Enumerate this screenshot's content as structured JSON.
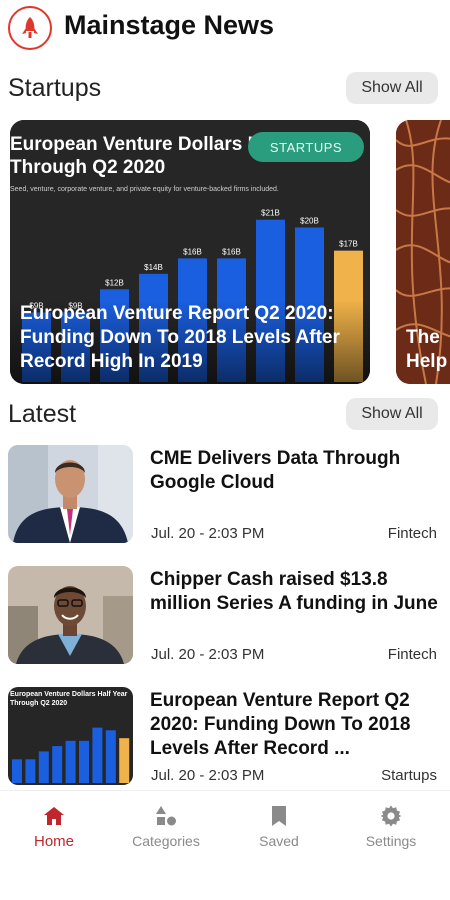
{
  "app": {
    "title": "Mainstage News",
    "logo_icon": "rocket-icon",
    "brand_color": "#e0372b"
  },
  "startups": {
    "section_title": "Startups",
    "show_all_label": "Show All",
    "feature": {
      "tag": "STARTUPS",
      "title": "European Venture Report Q2 2020: Funding Down To 2018 Levels After Record High In 2019",
      "image": {
        "heading_line1": "European Venture Dollars Half Year",
        "heading_line2": "Through Q2 2020",
        "subheading": "Seed, venture, corporate venture, and private equity for venture-backed firms included.",
        "bars": [
          {
            "label": "$9B",
            "value": 9
          },
          {
            "label": "$9B",
            "value": 9
          },
          {
            "label": "$12B",
            "value": 12
          },
          {
            "label": "$14B",
            "value": 14
          },
          {
            "label": "$16B",
            "value": 16
          },
          {
            "label": "$16B",
            "value": 16
          },
          {
            "label": "$21B",
            "value": 21
          },
          {
            "label": "$20B",
            "value": 20
          },
          {
            "label": "$17B",
            "value": 17
          }
        ],
        "bar_color": "#1a5fe0",
        "highlight_color": "#f0b24a"
      }
    },
    "peek": {
      "title": "The\nHelp"
    }
  },
  "latest": {
    "section_title": "Latest",
    "show_all_label": "Show All",
    "articles": [
      {
        "title": "CME Delivers Data Through Google Cloud",
        "time": "Jul. 20 - 2:03 PM",
        "category": "Fintech",
        "thumb": "man-in-suit"
      },
      {
        "title": "Chipper Cash raised $13.8 million Series A funding in June",
        "time": "Jul. 20 - 2:03 PM",
        "category": "Fintech",
        "thumb": "smiling-man"
      },
      {
        "title": "European Venture Report Q2 2020: Funding Down To 2018 Levels After Record ...",
        "time": "Jul. 20 - 2:03 PM",
        "category": "Startups",
        "thumb": "bar-chart"
      }
    ]
  },
  "nav": {
    "items": [
      {
        "label": "Home",
        "icon": "home-icon",
        "active": true
      },
      {
        "label": "Categories",
        "icon": "shapes-icon",
        "active": false
      },
      {
        "label": "Saved",
        "icon": "bookmark-icon",
        "active": false
      },
      {
        "label": "Settings",
        "icon": "gear-icon",
        "active": false
      }
    ],
    "active_color": "#c0262d",
    "inactive_color": "#8a8a8a"
  }
}
